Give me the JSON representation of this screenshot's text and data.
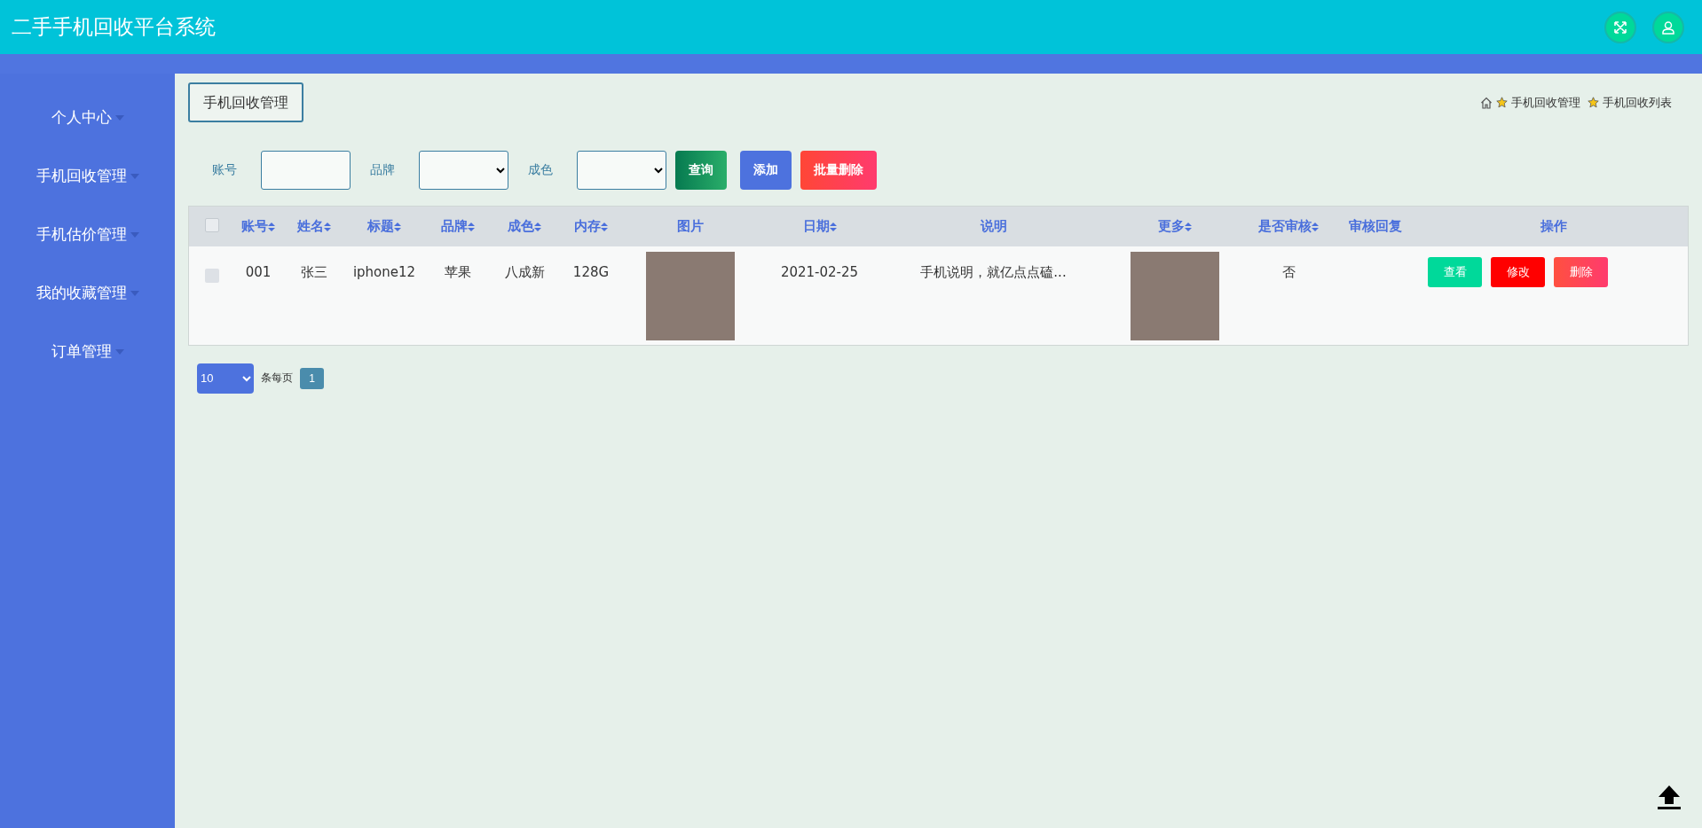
{
  "header": {
    "title": "二手手机回收平台系统"
  },
  "sidebar": {
    "items": [
      {
        "label": "个人中心"
      },
      {
        "label": "手机回收管理"
      },
      {
        "label": "手机估价管理"
      },
      {
        "label": "我的收藏管理"
      },
      {
        "label": "订单管理"
      }
    ]
  },
  "page_title": "手机回收管理",
  "breadcrumb": [
    "手机回收管理",
    "手机回收列表"
  ],
  "search": {
    "fields": [
      {
        "label": "账号",
        "kind": "input"
      },
      {
        "label": "品牌",
        "kind": "select"
      },
      {
        "label": "成色",
        "kind": "select"
      }
    ],
    "buttons": [
      {
        "label": "查询",
        "kind": "query"
      },
      {
        "label": "添加",
        "kind": "add"
      },
      {
        "label": "批量删除",
        "kind": "delete"
      }
    ]
  },
  "table": {
    "select_all": {
      "checked": false
    },
    "columns": [
      {
        "label": "账号",
        "sortable": true
      },
      {
        "label": "姓名",
        "sortable": true
      },
      {
        "label": "标题",
        "sortable": true
      },
      {
        "label": "品牌",
        "sortable": true
      },
      {
        "label": "成色",
        "sortable": true
      },
      {
        "label": "内存",
        "sortable": true
      },
      {
        "label": "图片",
        "sortable": false
      },
      {
        "label": "日期",
        "sortable": true
      },
      {
        "label": "说明",
        "sortable": false
      },
      {
        "label": "更多",
        "sortable": true
      },
      {
        "label": "是否审核",
        "sortable": true
      },
      {
        "label": "审核回复",
        "sortable": false
      },
      {
        "label": "操作",
        "sortable": false
      }
    ],
    "rows": [
      {
        "checked": false,
        "cells": [
          {
            "kind": "text",
            "text": "001"
          },
          {
            "kind": "text",
            "text": "张三"
          },
          {
            "kind": "text",
            "text": "iphone12"
          },
          {
            "kind": "text",
            "text": "苹果"
          },
          {
            "kind": "text",
            "text": "八成新"
          },
          {
            "kind": "text",
            "text": "128G"
          },
          {
            "kind": "photo"
          },
          {
            "kind": "text",
            "text": "2021-02-25"
          },
          {
            "kind": "text",
            "text": "手机说明，就亿点点磕..."
          },
          {
            "kind": "photo"
          },
          {
            "kind": "text",
            "text": "否"
          },
          {
            "kind": "empty"
          },
          {
            "kind": "actions",
            "buttons": [
              {
                "label": "查看",
                "kind": "view"
              },
              {
                "label": "修改",
                "kind": "edit"
              },
              {
                "label": "删除",
                "kind": "delete"
              }
            ]
          }
        ]
      }
    ]
  },
  "pagination": {
    "page_size": "10",
    "per_page_label": "条每页",
    "pages": [
      {
        "label": "1",
        "selected": true
      }
    ]
  }
}
